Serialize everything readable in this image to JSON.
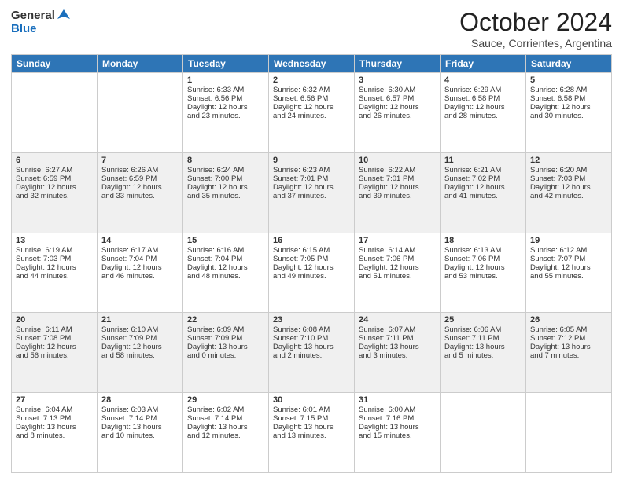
{
  "header": {
    "logo_general": "General",
    "logo_blue": "Blue",
    "month": "October 2024",
    "location": "Sauce, Corrientes, Argentina"
  },
  "weekdays": [
    "Sunday",
    "Monday",
    "Tuesday",
    "Wednesday",
    "Thursday",
    "Friday",
    "Saturday"
  ],
  "rows": [
    {
      "shaded": false,
      "cells": [
        {
          "day": "",
          "text": ""
        },
        {
          "day": "",
          "text": ""
        },
        {
          "day": "1",
          "text": "Sunrise: 6:33 AM\nSunset: 6:56 PM\nDaylight: 12 hours\nand 23 minutes."
        },
        {
          "day": "2",
          "text": "Sunrise: 6:32 AM\nSunset: 6:56 PM\nDaylight: 12 hours\nand 24 minutes."
        },
        {
          "day": "3",
          "text": "Sunrise: 6:30 AM\nSunset: 6:57 PM\nDaylight: 12 hours\nand 26 minutes."
        },
        {
          "day": "4",
          "text": "Sunrise: 6:29 AM\nSunset: 6:58 PM\nDaylight: 12 hours\nand 28 minutes."
        },
        {
          "day": "5",
          "text": "Sunrise: 6:28 AM\nSunset: 6:58 PM\nDaylight: 12 hours\nand 30 minutes."
        }
      ]
    },
    {
      "shaded": true,
      "cells": [
        {
          "day": "6",
          "text": "Sunrise: 6:27 AM\nSunset: 6:59 PM\nDaylight: 12 hours\nand 32 minutes."
        },
        {
          "day": "7",
          "text": "Sunrise: 6:26 AM\nSunset: 6:59 PM\nDaylight: 12 hours\nand 33 minutes."
        },
        {
          "day": "8",
          "text": "Sunrise: 6:24 AM\nSunset: 7:00 PM\nDaylight: 12 hours\nand 35 minutes."
        },
        {
          "day": "9",
          "text": "Sunrise: 6:23 AM\nSunset: 7:01 PM\nDaylight: 12 hours\nand 37 minutes."
        },
        {
          "day": "10",
          "text": "Sunrise: 6:22 AM\nSunset: 7:01 PM\nDaylight: 12 hours\nand 39 minutes."
        },
        {
          "day": "11",
          "text": "Sunrise: 6:21 AM\nSunset: 7:02 PM\nDaylight: 12 hours\nand 41 minutes."
        },
        {
          "day": "12",
          "text": "Sunrise: 6:20 AM\nSunset: 7:03 PM\nDaylight: 12 hours\nand 42 minutes."
        }
      ]
    },
    {
      "shaded": false,
      "cells": [
        {
          "day": "13",
          "text": "Sunrise: 6:19 AM\nSunset: 7:03 PM\nDaylight: 12 hours\nand 44 minutes."
        },
        {
          "day": "14",
          "text": "Sunrise: 6:17 AM\nSunset: 7:04 PM\nDaylight: 12 hours\nand 46 minutes."
        },
        {
          "day": "15",
          "text": "Sunrise: 6:16 AM\nSunset: 7:04 PM\nDaylight: 12 hours\nand 48 minutes."
        },
        {
          "day": "16",
          "text": "Sunrise: 6:15 AM\nSunset: 7:05 PM\nDaylight: 12 hours\nand 49 minutes."
        },
        {
          "day": "17",
          "text": "Sunrise: 6:14 AM\nSunset: 7:06 PM\nDaylight: 12 hours\nand 51 minutes."
        },
        {
          "day": "18",
          "text": "Sunrise: 6:13 AM\nSunset: 7:06 PM\nDaylight: 12 hours\nand 53 minutes."
        },
        {
          "day": "19",
          "text": "Sunrise: 6:12 AM\nSunset: 7:07 PM\nDaylight: 12 hours\nand 55 minutes."
        }
      ]
    },
    {
      "shaded": true,
      "cells": [
        {
          "day": "20",
          "text": "Sunrise: 6:11 AM\nSunset: 7:08 PM\nDaylight: 12 hours\nand 56 minutes."
        },
        {
          "day": "21",
          "text": "Sunrise: 6:10 AM\nSunset: 7:09 PM\nDaylight: 12 hours\nand 58 minutes."
        },
        {
          "day": "22",
          "text": "Sunrise: 6:09 AM\nSunset: 7:09 PM\nDaylight: 13 hours\nand 0 minutes."
        },
        {
          "day": "23",
          "text": "Sunrise: 6:08 AM\nSunset: 7:10 PM\nDaylight: 13 hours\nand 2 minutes."
        },
        {
          "day": "24",
          "text": "Sunrise: 6:07 AM\nSunset: 7:11 PM\nDaylight: 13 hours\nand 3 minutes."
        },
        {
          "day": "25",
          "text": "Sunrise: 6:06 AM\nSunset: 7:11 PM\nDaylight: 13 hours\nand 5 minutes."
        },
        {
          "day": "26",
          "text": "Sunrise: 6:05 AM\nSunset: 7:12 PM\nDaylight: 13 hours\nand 7 minutes."
        }
      ]
    },
    {
      "shaded": false,
      "cells": [
        {
          "day": "27",
          "text": "Sunrise: 6:04 AM\nSunset: 7:13 PM\nDaylight: 13 hours\nand 8 minutes."
        },
        {
          "day": "28",
          "text": "Sunrise: 6:03 AM\nSunset: 7:14 PM\nDaylight: 13 hours\nand 10 minutes."
        },
        {
          "day": "29",
          "text": "Sunrise: 6:02 AM\nSunset: 7:14 PM\nDaylight: 13 hours\nand 12 minutes."
        },
        {
          "day": "30",
          "text": "Sunrise: 6:01 AM\nSunset: 7:15 PM\nDaylight: 13 hours\nand 13 minutes."
        },
        {
          "day": "31",
          "text": "Sunrise: 6:00 AM\nSunset: 7:16 PM\nDaylight: 13 hours\nand 15 minutes."
        },
        {
          "day": "",
          "text": ""
        },
        {
          "day": "",
          "text": ""
        }
      ]
    }
  ]
}
